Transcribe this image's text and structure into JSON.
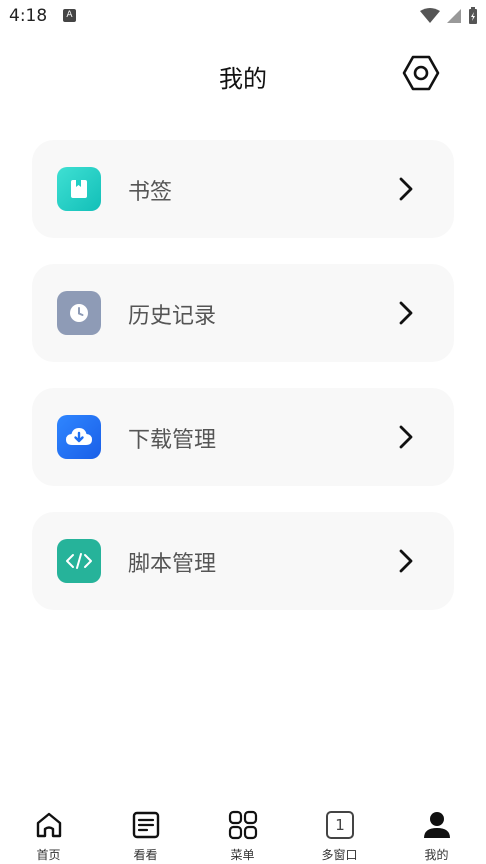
{
  "status_bar": {
    "time": "4:18",
    "notification_glyph": "A"
  },
  "header": {
    "title": "我的"
  },
  "menu": [
    {
      "label": "书签",
      "icon": "bookmark-icon",
      "color": "#1fcfc4"
    },
    {
      "label": "历史记录",
      "icon": "clock-icon",
      "color": "#8e9bb6"
    },
    {
      "label": "下载管理",
      "icon": "cloud-download-icon",
      "color": "#1e6ff2"
    },
    {
      "label": "脚本管理",
      "icon": "code-icon",
      "color": "#26b39a"
    }
  ],
  "tabs": [
    {
      "label": "首页",
      "icon": "home-icon"
    },
    {
      "label": "看看",
      "icon": "document-icon"
    },
    {
      "label": "菜单",
      "icon": "grid-icon"
    },
    {
      "label": "多窗口",
      "icon": "window-count-icon",
      "count": "1"
    },
    {
      "label": "我的",
      "icon": "person-icon",
      "active": true
    }
  ]
}
